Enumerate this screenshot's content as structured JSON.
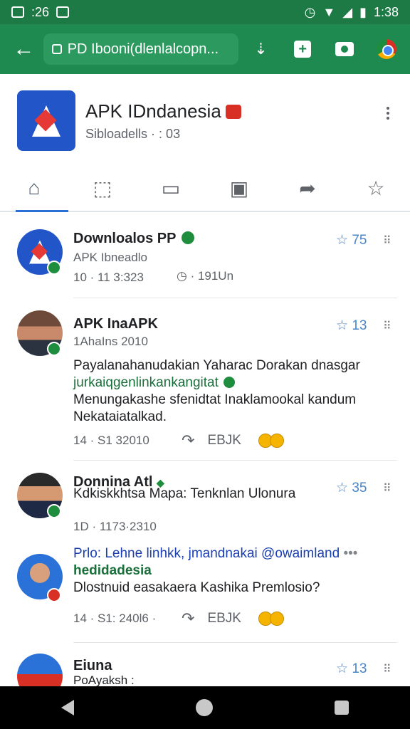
{
  "status_bar": {
    "time_left": ":26",
    "time_right": "1:38"
  },
  "toolbar": {
    "url": "PD Ibooni(dlenlalcopn..."
  },
  "profile": {
    "title": "APK IDndanesia",
    "subtitle": "Sibloadells · : 03",
    "tabs": [
      {
        "name": "home",
        "icon": "home-icon"
      },
      {
        "name": "repost",
        "icon": "repost-icon"
      },
      {
        "name": "comment",
        "icon": "comment-icon"
      },
      {
        "name": "media",
        "icon": "media-icon"
      },
      {
        "name": "share",
        "icon": "share-icon"
      },
      {
        "name": "favorite",
        "icon": "star-icon"
      }
    ]
  },
  "posts": [
    {
      "name": "Downloalos PP",
      "handle": "APK Ibneadlo",
      "date": "10 · 11 3:323",
      "extra": "· 191Un",
      "stars": "75"
    },
    {
      "name": "APK InaAPK",
      "handle": "1AhaIns 2010",
      "stars": "13",
      "line1": "Payalanahanudakian Yaharac Dorakan dnasgar",
      "line2": "jurkaiqgenlinkankangitat",
      "line3": "Menungakashe sfenidtat Inaklamookal kandum",
      "line4": "Nekataiatalkad.",
      "date": "14 · S1 32010",
      "action_label": "EBJK"
    },
    {
      "name": "Donnina Atl",
      "handle": "Kdkiskkhtsa Mapa: Tenknlan Ulonura",
      "stars": "35",
      "date": "1D · 1173·2310"
    },
    {
      "line1": "Prlo: Lehne linhkk, jmandnakai @owaimland",
      "line2": "hedidadesia",
      "line3": "Dlostnuid easakaera Kashika Premlosio?",
      "date": "14 · S1: 240l6 ·",
      "action_label": "EBJK"
    },
    {
      "name": "Eiuna",
      "handle": "PoAyaksh :",
      "stars": "13"
    }
  ]
}
